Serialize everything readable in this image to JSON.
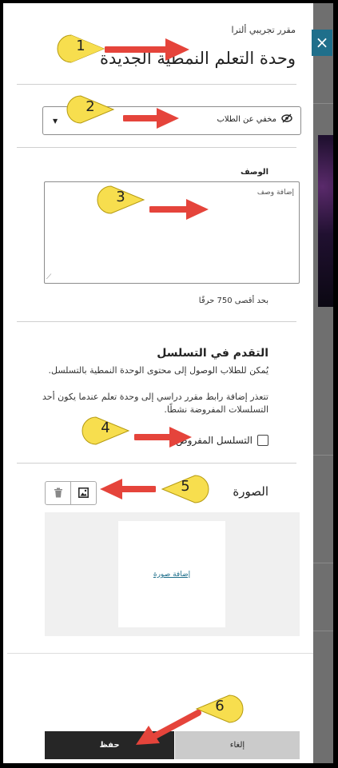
{
  "header": {
    "subtitle": "مقرر تجريبي ألترا",
    "title": "وحدة التعلم النمطية الجديدة"
  },
  "close_icon": "×",
  "visibility": {
    "selected": "مخفي عن الطلاب",
    "icon": "eye-slash-icon"
  },
  "description": {
    "label": "الوصف",
    "placeholder": "إضافة وصف",
    "max_chars": "بحد أقصى 750 حرفًا"
  },
  "sequence": {
    "title": "التقدم في التسلسل",
    "desc": "يُمكن للطلاب الوصول إلى محتوى الوحدة النمطية بالتسلسل.",
    "note": "تتعذر إضافة رابط مقرر دراسي إلى وحدة تعلم عندما يكون أحد التسلسلات المفروضة نشطًا.",
    "checkbox_label": "التسلسل المفروض",
    "checked": false
  },
  "image": {
    "title": "الصورة",
    "add_link": "إضافة صورة"
  },
  "footer": {
    "save": "حفظ",
    "cancel": "إلغاء"
  },
  "callouts": [
    "1",
    "2",
    "3",
    "4",
    "5",
    "6"
  ],
  "colors": {
    "accent": "#1f6f8b",
    "callout_fill": "#f7de4e",
    "arrow": "#e5443b",
    "save_bg": "#262626",
    "cancel_bg": "#cbcbcb"
  }
}
